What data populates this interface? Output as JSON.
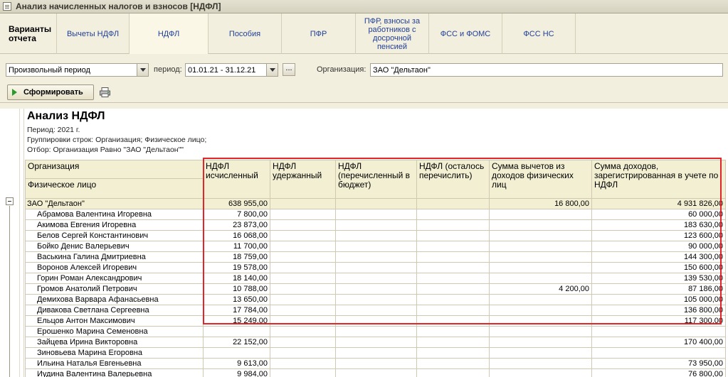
{
  "window": {
    "title": "Анализ начисленных налогов и взносов [НДФЛ]"
  },
  "tabs": [
    {
      "label": "Варианты отчета"
    },
    {
      "label": "Вычеты НДФЛ"
    },
    {
      "label": "НДФЛ"
    },
    {
      "label": "Пособия"
    },
    {
      "label": "ПФР"
    },
    {
      "label": "ПФР, взносы за работников с досрочной пенсией"
    },
    {
      "label": "ФСС и ФОМС"
    },
    {
      "label": "ФСС НС"
    }
  ],
  "filters": {
    "period_type": "Произвольный период",
    "period_label": "период:",
    "period_value": "01.01.21 - 31.12.21",
    "dots": "...",
    "org_label": "Организация:",
    "org_value": "ЗАО \"Дельтаон\""
  },
  "toolbar": {
    "generate_label": "Сформировать"
  },
  "report": {
    "title": "Анализ НДФЛ",
    "period": "Период: 2021 г.",
    "grouping": "Группировки строк: Организация; Физическое лицо;",
    "filter": "Отбор: Организация Равно \"ЗАО \"Дельтаон\"\"",
    "header": {
      "org": "Организация",
      "person": "Физическое лицо",
      "cols": [
        "НДФЛ исчисленный",
        "НДФЛ удержанный",
        "НДФЛ (перечисленный в бюджет)",
        "НДФЛ (осталось перечислить)",
        "Сумма вычетов из доходов физических лиц",
        "Сумма доходов, зарегистрированная в учете по НДФЛ"
      ]
    },
    "total": {
      "name": "ЗАО \"Дельтаон\"",
      "v": [
        "638 955,00",
        "",
        "",
        "",
        "16 800,00",
        "4 931 826,00"
      ]
    },
    "rows": [
      {
        "name": "Абрамова Валентина Игоревна",
        "v": [
          "7 800,00",
          "",
          "",
          "",
          "",
          "60 000,00"
        ]
      },
      {
        "name": "Акимова Евгения Игоревна",
        "v": [
          "23 873,00",
          "",
          "",
          "",
          "",
          "183 630,00"
        ]
      },
      {
        "name": "Белов Сергей Константинович",
        "v": [
          "16 068,00",
          "",
          "",
          "",
          "",
          "123 600,00"
        ]
      },
      {
        "name": "Бойко Денис Валерьевич",
        "v": [
          "11 700,00",
          "",
          "",
          "",
          "",
          "90 000,00"
        ]
      },
      {
        "name": "Васькина Галина Дмитриевна",
        "v": [
          "18 759,00",
          "",
          "",
          "",
          "",
          "144 300,00"
        ]
      },
      {
        "name": "Воронов Алексей Игоревич",
        "v": [
          "19 578,00",
          "",
          "",
          "",
          "",
          "150 600,00"
        ]
      },
      {
        "name": "Горин Роман Александрович",
        "v": [
          "18 140,00",
          "",
          "",
          "",
          "",
          "139 530,00"
        ]
      },
      {
        "name": "Громов Анатолий Петрович",
        "v": [
          "10 788,00",
          "",
          "",
          "",
          "4 200,00",
          "87 186,00"
        ]
      },
      {
        "name": "Демихова Варвара Афанасьевна",
        "v": [
          "13 650,00",
          "",
          "",
          "",
          "",
          "105 000,00"
        ]
      },
      {
        "name": "Дивакова Светлана Сергеевна",
        "v": [
          "17 784,00",
          "",
          "",
          "",
          "",
          "136 800,00"
        ]
      },
      {
        "name": "Ельцов Антон Максимович",
        "v": [
          "15 249,00",
          "",
          "",
          "",
          "",
          "117 300,00"
        ]
      },
      {
        "name": "Ерошенко Марина Семеновна",
        "v": [
          "",
          "",
          "",
          "",
          "",
          ""
        ]
      },
      {
        "name": "Зайцева Ирина Викторовна",
        "v": [
          "22 152,00",
          "",
          "",
          "",
          "",
          "170 400,00"
        ]
      },
      {
        "name": "Зиновьева Марина Егоровна",
        "v": [
          "",
          "",
          "",
          "",
          "",
          ""
        ]
      },
      {
        "name": "Ильина Наталья Евгеньевна",
        "v": [
          "9 613,00",
          "",
          "",
          "",
          "",
          "73 950,00"
        ]
      },
      {
        "name": "Иудина Валентина Валерьевна",
        "v": [
          "9 984,00",
          "",
          "",
          "",
          "",
          "76 800,00"
        ]
      }
    ]
  },
  "colors": {
    "highlight": "#e1252b",
    "header_bg": "#f3efd2",
    "link": "#1f3f9a"
  }
}
